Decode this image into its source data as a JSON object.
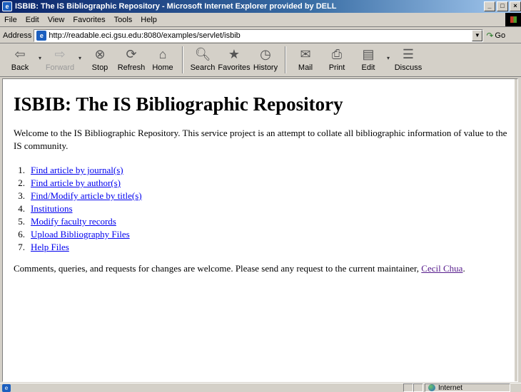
{
  "window": {
    "title": "ISBIB: The IS Bibliographic Repository - Microsoft Internet Explorer provided by DELL",
    "buttons": [
      "_",
      "□",
      "×"
    ]
  },
  "menu": [
    {
      "label": "File"
    },
    {
      "label": "Edit"
    },
    {
      "label": "View"
    },
    {
      "label": "Favorites"
    },
    {
      "label": "Tools"
    },
    {
      "label": "Help"
    }
  ],
  "address": {
    "label": "Address",
    "url": "http://readable.eci.gsu.edu:8080/examples/servlet/isbib",
    "go_label": "Go"
  },
  "toolbar": {
    "back": "Back",
    "forward": "Forward",
    "stop": "Stop",
    "refresh": "Refresh",
    "home": "Home",
    "search": "Search",
    "favorites": "Favorites",
    "history": "History",
    "mail": "Mail",
    "print": "Print",
    "edit": "Edit",
    "discuss": "Discuss"
  },
  "page": {
    "heading": "ISBIB: The IS Bibliographic Repository",
    "intro": "Welcome to the IS Bibliographic Repository. This service project is an attempt to collate all bibliographic information of value to the IS community.",
    "links": [
      {
        "num": "1.",
        "label": "Find article by journal(s)"
      },
      {
        "num": "2.",
        "label": "Find article by author(s)"
      },
      {
        "num": "3.",
        "label": "Find/Modify article by title(s)"
      },
      {
        "num": "4.",
        "label": "Institutions"
      },
      {
        "num": "5.",
        "label": "Modify faculty records"
      },
      {
        "num": "6.",
        "label": "Upload Bibliography Files"
      },
      {
        "num": "7.",
        "label": "Help Files"
      }
    ],
    "comments_text": "Comments, queries, and requests for changes are welcome. Please send any request to the current maintainer, ",
    "maintainer": "Cecil Chua",
    "comments_end": "."
  },
  "status": {
    "zone": "Internet"
  }
}
